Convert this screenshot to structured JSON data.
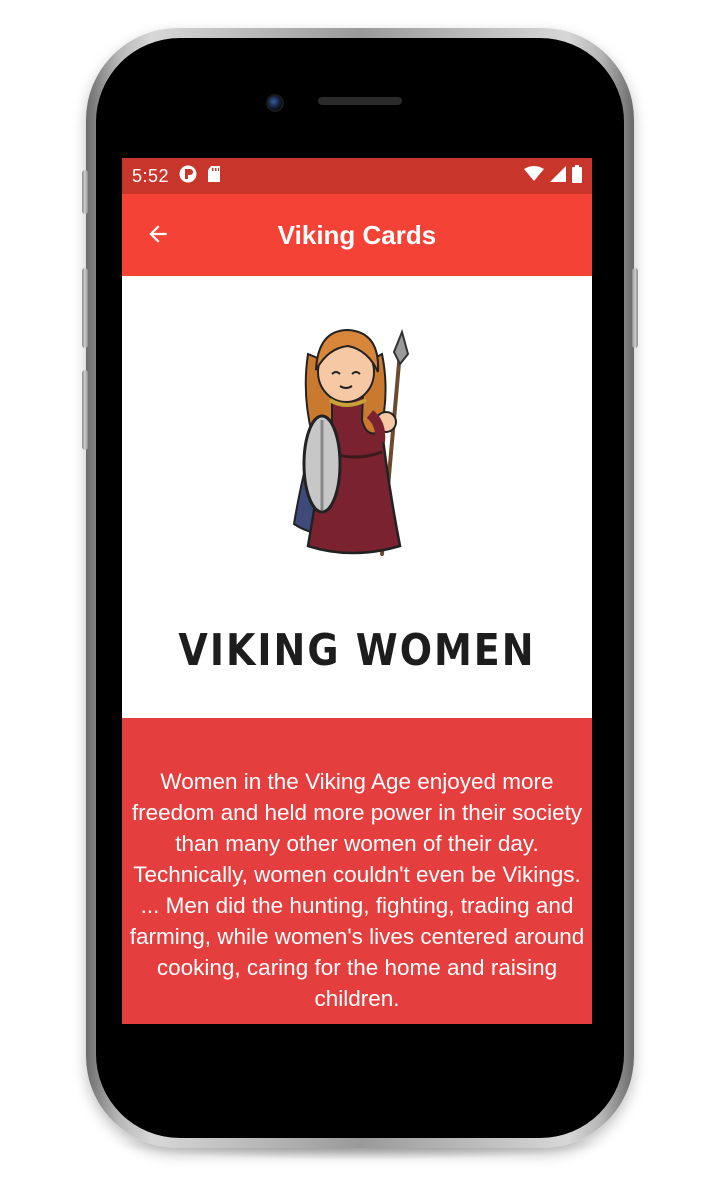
{
  "status_bar": {
    "time": "5:52",
    "left_icons": [
      "app-notification-icon",
      "sd-card-icon"
    ],
    "right_icons": [
      "wifi-icon",
      "signal-icon",
      "battery-icon"
    ]
  },
  "app_bar": {
    "title": "Viking Cards",
    "back_icon": "arrow-back-icon"
  },
  "card": {
    "image": "viking-woman-illustration",
    "title": "VIKING WOMEN"
  },
  "description": {
    "text": "Women in the Viking Age enjoyed more freedom and held more power in their society than many other women of their day. Technically, women couldn't even be Vikings. ... Men did the hunting, fighting, trading and farming, while women's lives centered around cooking, caring for the home and raising children."
  },
  "colors": {
    "status_bar": "#c8362b",
    "app_bar": "#f44336",
    "description_panel": "#e53e3e",
    "title_text": "#1d1d1d"
  }
}
